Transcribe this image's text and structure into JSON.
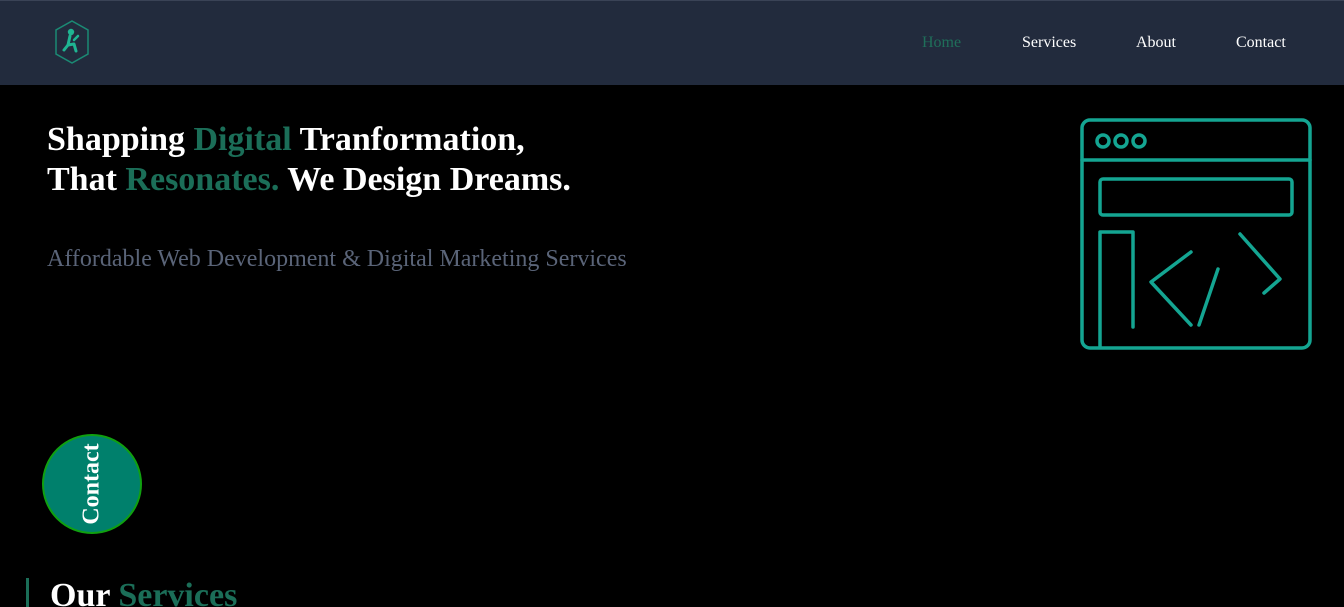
{
  "header": {
    "logo_icon": "runner-hexagon-logo-icon",
    "nav": [
      {
        "label": "Home",
        "active": true
      },
      {
        "label": "Services",
        "active": false
      },
      {
        "label": "About",
        "active": false
      },
      {
        "label": "Contact",
        "active": false
      }
    ]
  },
  "hero": {
    "title_line1": {
      "part1": "Shapping ",
      "accent": "Digital",
      "part2": " Tranformation,"
    },
    "title_line2": {
      "part1": "That ",
      "accent": "Resonates.",
      "part2": " We Design Dreams."
    },
    "subtitle": "Affordable Web Development & Digital Marketing Services",
    "illustration_icon": "browser-code-icon"
  },
  "contact_button": {
    "label": "Contact"
  },
  "services_section": {
    "title_part1": "Our ",
    "title_accent": "Services"
  },
  "colors": {
    "header_bg": "#222b3d",
    "page_bg": "#000000",
    "accent": "#1b6e58",
    "illustration_stroke": "#14a592",
    "contact_bg": "#00806c",
    "subtitle": "#5a6478"
  }
}
